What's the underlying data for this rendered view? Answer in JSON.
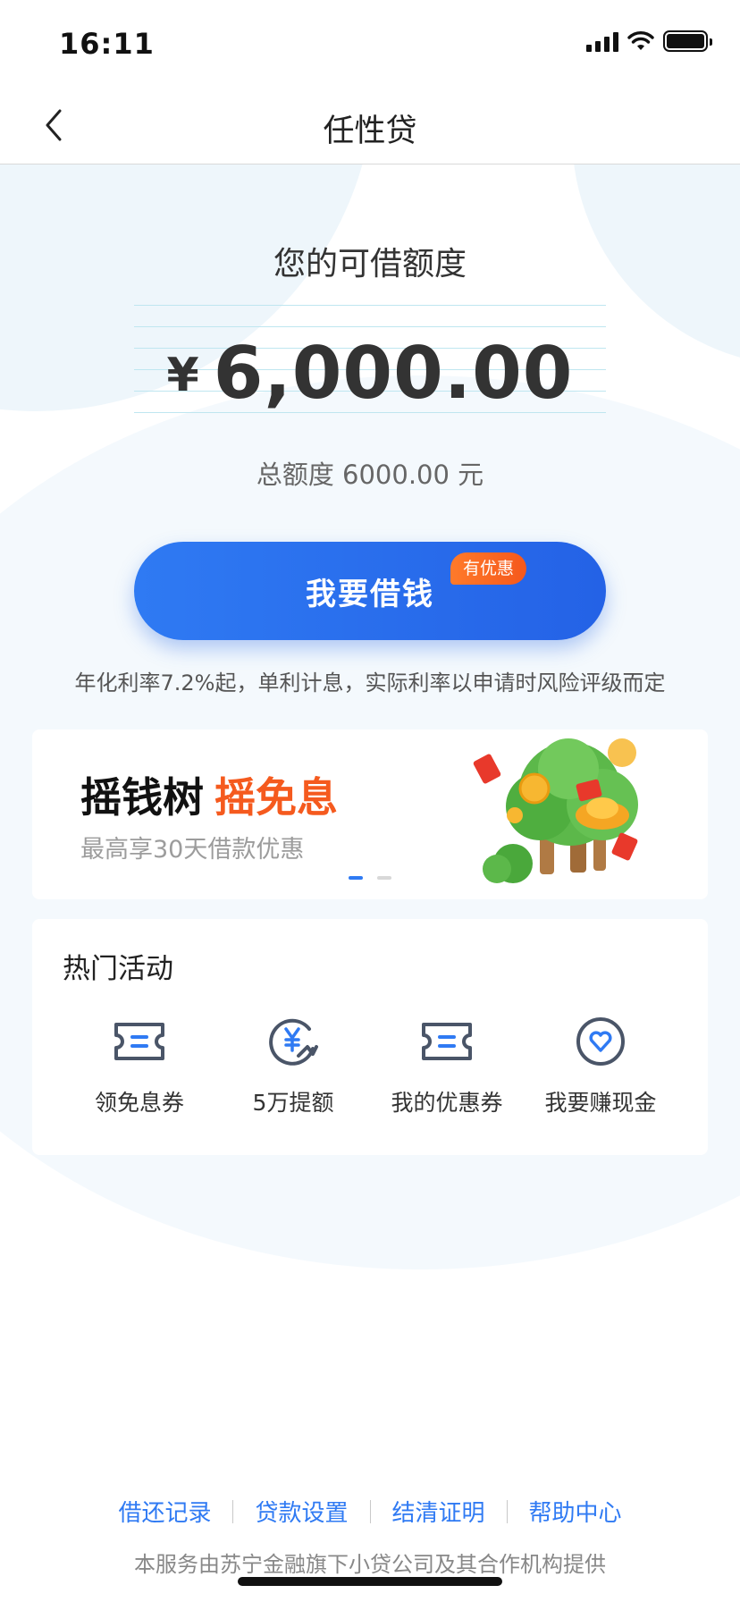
{
  "status_bar": {
    "time": "16:11"
  },
  "nav": {
    "title": "任性贷"
  },
  "credit": {
    "label": "您的可借额度",
    "currency_symbol": "¥",
    "amount": "6,000.00",
    "total_line": "总额度 6000.00 元"
  },
  "borrow": {
    "button_label": "我要借钱",
    "promo_tag": "有优惠",
    "rate_note": "年化利率7.2%起，单利计息，实际利率以申请时风险评级而定"
  },
  "banner": {
    "title_main": "摇钱树",
    "title_highlight": "摇免息",
    "subtitle": "最高享30天借款优惠",
    "active_index": 0,
    "dot_count": 2
  },
  "activities": {
    "title": "热门活动",
    "items": [
      {
        "label": "领免息券",
        "icon": "ticket-icon"
      },
      {
        "label": "5万提额",
        "icon": "yuan-boost-icon"
      },
      {
        "label": "我的优惠券",
        "icon": "coupon-icon"
      },
      {
        "label": "我要赚现金",
        "icon": "heart-badge-icon"
      }
    ]
  },
  "footer": {
    "links": [
      "借还记录",
      "贷款设置",
      "结清证明",
      "帮助中心"
    ],
    "note": "本服务由苏宁金融旗下小贷公司及其合作机构提供"
  },
  "colors": {
    "accent": "#2f7af3",
    "promo": "#f55a1e",
    "text_dark": "#222222",
    "background_tint": "#eef6fb"
  }
}
